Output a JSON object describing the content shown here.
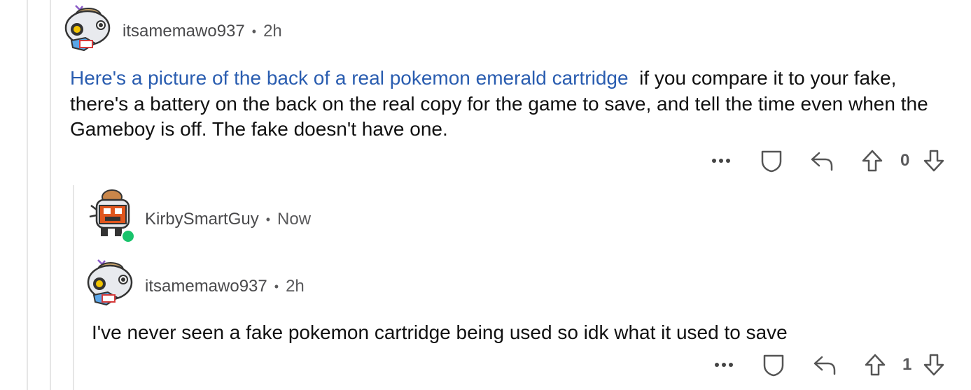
{
  "comments": [
    {
      "username": "itsamemawo937",
      "separator": "•",
      "time": "2h",
      "link_text": "Here's a picture of the back of a real pokemon emerald cartridge",
      "body_text": "if you compare it to your fake, there's a battery on the back on the real copy for the game to save, and tell the time even when the Gameboy is off. The fake doesn't have one.",
      "score": "0",
      "avatar_icon": "snoo-gamer-avatar-icon"
    },
    {
      "username": "KirbySmartGuy",
      "separator": "•",
      "time": "Now",
      "online": true,
      "avatar_icon": "snoo-robot-avatar-icon"
    },
    {
      "username": "itsamemawo937",
      "separator": "•",
      "time": "2h",
      "body_text": "I've never seen a fake pokemon cartridge being used so idk what it used to save",
      "score": "1",
      "avatar_icon": "snoo-gamer-avatar-icon"
    }
  ],
  "icons": {
    "more": "more-options-icon",
    "award": "award-shield-icon",
    "reply": "reply-arrow-icon",
    "upvote": "upvote-arrow-icon",
    "downvote": "downvote-arrow-icon"
  },
  "colors": {
    "link": "#2a5db0",
    "online": "#18c36b",
    "thread_line": "#e6e6e6"
  }
}
